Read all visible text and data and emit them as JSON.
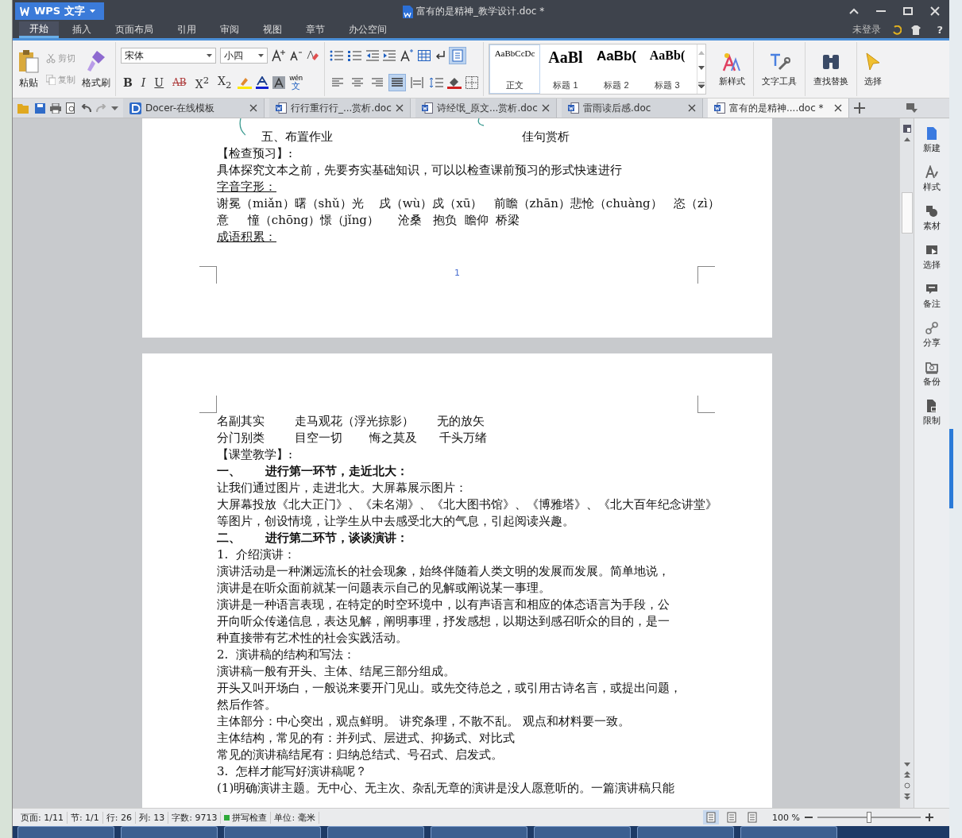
{
  "app_button": "WPS 文字",
  "title": "富有的是精神_教学设计.doc *",
  "menu_tabs": [
    {
      "label": "开始",
      "selected": true
    },
    {
      "label": "插入",
      "selected": false
    },
    {
      "label": "页面布局",
      "selected": false
    },
    {
      "label": "引用",
      "selected": false
    },
    {
      "label": "审阅",
      "selected": false
    },
    {
      "label": "视图",
      "selected": false
    },
    {
      "label": "章节",
      "selected": false
    },
    {
      "label": "办公空间",
      "selected": false
    }
  ],
  "account": "未登录",
  "help": "?",
  "clipboard": {
    "paste": "粘贴",
    "cut": "剪切",
    "copy": "复制",
    "format_painter": "格式刷"
  },
  "font": {
    "name": "宋体",
    "size": "小四"
  },
  "format_buttons": [
    {
      "kind": "bold",
      "glyph": "B"
    },
    {
      "kind": "italic",
      "glyph": "I"
    },
    {
      "kind": "underline",
      "glyph": "U"
    },
    {
      "kind": "strike",
      "glyph": "AB"
    },
    {
      "kind": "sup",
      "glyph": "X$^{2}$"
    },
    {
      "kind": "sub",
      "glyph": "X$_{2}$"
    }
  ],
  "phonetic": {
    "top": "wén",
    "bottom": "文"
  },
  "align_buttons": [
    {
      "kind": "left",
      "selected": false
    },
    {
      "kind": "center",
      "selected": false
    },
    {
      "kind": "right",
      "selected": false
    },
    {
      "kind": "justify",
      "selected": true
    },
    {
      "kind": "distributed",
      "selected": false
    }
  ],
  "show_marks": {
    "selected": true
  },
  "styles": [
    {
      "kind": "normal",
      "preview": "AaBbCcDc",
      "name": "正文",
      "selected": true
    },
    {
      "kind": "h1",
      "preview": "AaBl",
      "name": "标题 1",
      "selected": false
    },
    {
      "kind": "h2",
      "preview": "AaBb(",
      "name": "标题 2",
      "selected": false
    },
    {
      "kind": "h3",
      "preview": "AaBb(",
      "name": "标题 3",
      "selected": false
    }
  ],
  "ribbon_tools": [
    {
      "kind": "newstyle",
      "label": "新样式"
    },
    {
      "kind": "texttools",
      "label": "文字工具"
    },
    {
      "kind": "find",
      "label": "查找替换"
    },
    {
      "kind": "select",
      "label": "选择"
    }
  ],
  "doc_tabs": [
    {
      "kind": "docer",
      "title": "Docer-在线模板",
      "selected": false
    },
    {
      "kind": "doc",
      "title": "行行重行行_...赏析.doc",
      "selected": false
    },
    {
      "kind": "doc",
      "title": "诗经氓_原文...赏析.doc",
      "selected": false
    },
    {
      "kind": "doc",
      "title": "雷雨读后感.doc",
      "selected": false
    },
    {
      "kind": "doc",
      "title": "富有的是精神....doc *",
      "selected": true
    }
  ],
  "page1": {
    "lines": [
      {
        "kind": "outline",
        "cells": [
          "五、布置作业",
          "佳句赏析"
        ]
      },
      {
        "kind": "plain",
        "text": "【检查预习】:"
      },
      {
        "kind": "plain",
        "text": "具体探究文本之前，先要夯实基础知识，可以以检查课前预习的形式快速进行"
      },
      {
        "kind": "underline",
        "text": "字音字形："
      },
      {
        "kind": "plain",
        "text": "谢冕（miǎn）曙（shǔ）光    戌（wù）戍（xū）   前瞻（zhān）悲怆（chuàng）   恣（zì）"
      },
      {
        "kind": "plain",
        "text": "意     憧（chōng）憬（jǐng）     沧桑   抱负  瞻仰  桥梁"
      },
      {
        "kind": "underline",
        "text": "成语积累："
      }
    ],
    "page_number": "1"
  },
  "page2": {
    "lines": [
      {
        "kind": "plain",
        "text": "名副其实        走马观花（浮光掠影）      无的放矢"
      },
      {
        "kind": "plain",
        "text": "分门别类        目空一切       悔之莫及      千头万绪"
      },
      {
        "kind": "plain",
        "text": "【课堂教学】:"
      },
      {
        "kind": "bold",
        "text": "一、      进行第一环节，走近北大："
      },
      {
        "kind": "plain",
        "text": "让我们通过图片，走进北大。大屏幕展示图片："
      },
      {
        "kind": "plain",
        "text": "大屏幕投放《北大正门》、《未名湖》、《北大图书馆》、《博雅塔》、《北大百年纪念讲堂》"
      },
      {
        "kind": "plain",
        "text": "等图片，创设情境，让学生从中去感受北大的气息，引起阅读兴趣。"
      },
      {
        "kind": "bold",
        "text": "二、      进行第二环节，谈谈演讲："
      },
      {
        "kind": "plain",
        "text": "1.  介绍演讲："
      },
      {
        "kind": "plain",
        "text": "演讲活动是一种渊远流长的社会现象，始终伴随着人类文明的发展而发展。简单地说，"
      },
      {
        "kind": "plain",
        "text": "演讲是在听众面前就某一问题表示自己的见解或阐说某一事理。"
      },
      {
        "kind": "plain",
        "text": "演讲是一种语言表现，在特定的时空环境中，以有声语言和相应的体态语言为手段，公"
      },
      {
        "kind": "plain",
        "text": "开向听众传递信息，表达见解，阐明事理，抒发感想，以期达到感召听众的目的，是一"
      },
      {
        "kind": "plain",
        "text": "种直接带有艺术性的社会实践活动。"
      },
      {
        "kind": "plain",
        "text": "2.  演讲稿的结构和写法："
      },
      {
        "kind": "plain",
        "text": "演讲稿一般有开头、主体、结尾三部分组成。"
      },
      {
        "kind": "plain",
        "text": "开头又叫开场白，一般说来要开门见山。或先交待总之，或引用古诗名言，或提出问题，"
      },
      {
        "kind": "plain",
        "text": "然后作答。"
      },
      {
        "kind": "plain",
        "text": "主体部分：中心突出，观点鲜明。 讲究条理，不散不乱。 观点和材料要一致。"
      },
      {
        "kind": "plain",
        "text": "主体结构，常见的有：并列式、层进式、抑扬式、对比式"
      },
      {
        "kind": "plain",
        "text": "常见的演讲稿结尾有：归纳总结式、号召式、启发式。"
      },
      {
        "kind": "plain",
        "text": "3.  怎样才能写好演讲稿呢？"
      },
      {
        "kind": "plain",
        "text": "(1)明确演讲主题。无中心、无主次、杂乱无章的演讲是没人愿意听的。一篇演讲稿只能"
      }
    ]
  },
  "sidebar": [
    {
      "kind": "new",
      "label": "新建"
    },
    {
      "kind": "style",
      "label": "样式"
    },
    {
      "kind": "material",
      "label": "素材"
    },
    {
      "kind": "select",
      "label": "选择"
    },
    {
      "kind": "note",
      "label": "备注"
    },
    {
      "kind": "share",
      "label": "分享"
    },
    {
      "kind": "backup",
      "label": "备份"
    },
    {
      "kind": "restrict",
      "label": "限制"
    }
  ],
  "status_bar": {
    "items": [
      "页面: 1/11",
      "节: 1/1",
      "行: 26",
      "列: 13",
      "字数: 9713"
    ],
    "spell_check": {
      "label": "拼写检查",
      "on": true
    },
    "unit": "单位: 毫米",
    "views": [
      {
        "selected": true
      },
      {
        "selected": false
      },
      {
        "selected": false
      }
    ],
    "zoom": "100 %",
    "zoom_slider": {
      "level": 0.5
    }
  }
}
